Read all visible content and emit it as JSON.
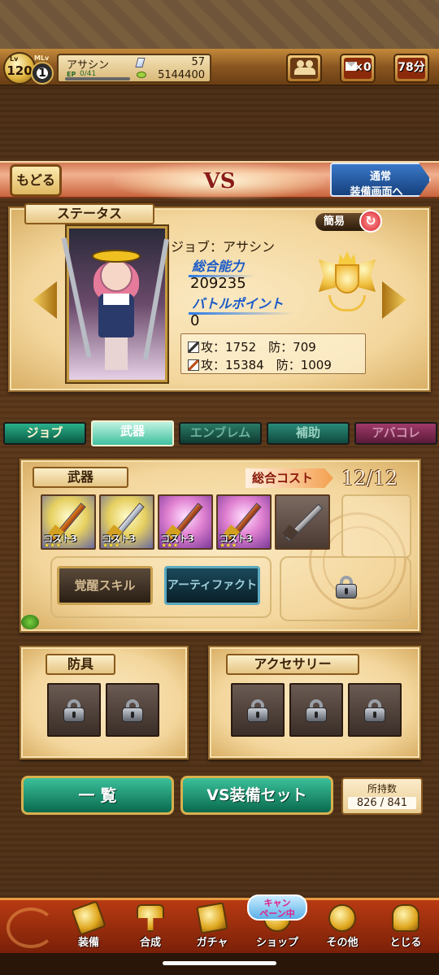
{
  "header": {
    "level_label": "Lv",
    "level": "120",
    "mlv_label": "MLv",
    "mlv": "1",
    "player_name": "アサシン",
    "ep_label": "EP",
    "ep_value": "0/41",
    "ep_progress": 0,
    "crystals": "57",
    "gold": "5144400",
    "mail_count": "×0",
    "stamina_time": "78分"
  },
  "banner": {
    "back_label": "もどる",
    "title": "VS",
    "normal_line1": "通常",
    "normal_line2": "装備画面へ"
  },
  "status": {
    "ribbon": "ステータス",
    "simple_label": "簡易",
    "job": "ジョブ：アサシン",
    "total_power_label": "総合能力",
    "total_power": "209235",
    "battle_point_label": "バトルポイント",
    "battle_points": "0",
    "phys_row": "攻：1752　防：709",
    "mag_row": "攻：15384　防：1009"
  },
  "tabs": [
    {
      "label": "ジョブ"
    },
    {
      "label": "武器"
    },
    {
      "label": "エンブレム"
    },
    {
      "label": "補助"
    },
    {
      "label": "アバコレ"
    }
  ],
  "weapons": {
    "ribbon": "武器",
    "cost_label": "総合コスト",
    "cost_value": "12/12",
    "cards": [
      {
        "cost": "コスト3",
        "stars": "★★★"
      },
      {
        "cost": "コスト3",
        "stars": "★★★"
      },
      {
        "cost": "コスト3",
        "stars": "★★★"
      },
      {
        "cost": "コスト3",
        "stars": "★★★"
      }
    ],
    "awaken_skill": "覚醒スキル",
    "artifact": "アーティファクト"
  },
  "armor": {
    "ribbon": "防具"
  },
  "accessory": {
    "ribbon": "アクセサリー"
  },
  "actions": {
    "list_label": "一 覧",
    "vs_set_label": "VS装備セット",
    "owned_label": "所持数",
    "owned_value": "826 / 841"
  },
  "footer": {
    "campaign_line1": "キャン",
    "campaign_line2": "ペーン中",
    "items": [
      {
        "label": "装備"
      },
      {
        "label": "合成"
      },
      {
        "label": "ガチャ"
      },
      {
        "label": "ショップ"
      },
      {
        "label": "その他"
      },
      {
        "label": "とじる"
      }
    ]
  }
}
